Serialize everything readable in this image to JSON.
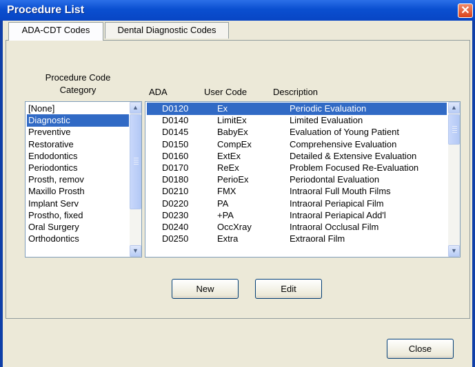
{
  "window": {
    "title": "Procedure List",
    "close_glyph": "✕"
  },
  "tabs": [
    {
      "label": "ADA-CDT Codes",
      "active": true
    },
    {
      "label": "Dental Diagnostic Codes",
      "active": false
    }
  ],
  "category": {
    "label_line1": "Procedure Code",
    "label_line2": "Category",
    "items": [
      "[None]",
      "Diagnostic",
      "Preventive",
      "Restorative",
      "Endodontics",
      "Periodontics",
      "Prosth, remov",
      "Maxillo Prosth",
      "Implant Serv",
      "Prostho, fixed",
      "Oral Surgery",
      "Orthodontics"
    ],
    "selected_index": 1
  },
  "procedures": {
    "columns": {
      "ada": "ADA",
      "user_code": "User Code",
      "description": "Description"
    },
    "rows": [
      {
        "ada": "D0120",
        "user_code": "Ex",
        "description": "Periodic Evaluation"
      },
      {
        "ada": "D0140",
        "user_code": "LimitEx",
        "description": "Limited Evaluation"
      },
      {
        "ada": "D0145",
        "user_code": "BabyEx",
        "description": "Evaluation of Young Patient"
      },
      {
        "ada": "D0150",
        "user_code": "CompEx",
        "description": "Comprehensive Evaluation"
      },
      {
        "ada": "D0160",
        "user_code": "ExtEx",
        "description": "Detailed & Extensive Evaluation"
      },
      {
        "ada": "D0170",
        "user_code": "ReEx",
        "description": "Problem Focused Re-Evaluation"
      },
      {
        "ada": "D0180",
        "user_code": "PerioEx",
        "description": "Periodontal Evaluation"
      },
      {
        "ada": "D0210",
        "user_code": "FMX",
        "description": "Intraoral Full Mouth Films"
      },
      {
        "ada": "D0220",
        "user_code": "PA",
        "description": "Intraoral Periapical Film"
      },
      {
        "ada": "D0230",
        "user_code": "+PA",
        "description": "Intraoral Periapical Add'l"
      },
      {
        "ada": "D0240",
        "user_code": "OccXray",
        "description": "Intraoral Occlusal Film"
      },
      {
        "ada": "D0250",
        "user_code": "Extra",
        "description": "Extraoral Film"
      }
    ],
    "selected_index": 0
  },
  "buttons": {
    "new": "New",
    "edit": "Edit",
    "close": "Close"
  },
  "icons": {
    "scroll_up": "▲",
    "scroll_down": "▼"
  },
  "colors": {
    "selection": "#316ac5",
    "titlebar": "#0a4fd0",
    "face": "#ece9d8"
  }
}
